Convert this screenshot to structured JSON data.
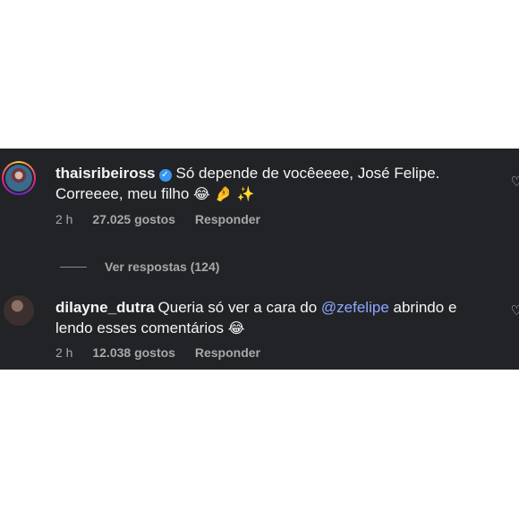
{
  "comments": [
    {
      "username": "thaisribeiross",
      "verified": true,
      "text_line1": "Só depende de vocêeeee, José Felipe.",
      "text_line2": "Correeee, meu filho",
      "emojis": "😂 🤌 ✨",
      "time": "2 h",
      "likes": "27.025 gostos",
      "reply_label": "Responder",
      "view_replies": "Ver respostas (124)"
    },
    {
      "username": "dilayne_dutra",
      "verified": false,
      "text_before": "Queria só ver a cara do ",
      "mention": "@zefelipe",
      "text_after": " abrindo e",
      "text_line2": "lendo esses comentários",
      "emojis": "😂",
      "time": "2 h",
      "likes": "12.038 gostos",
      "reply_label": "Responder"
    }
  ],
  "icons": {
    "heart": "heart-outline-icon",
    "verified": "verified-badge-icon"
  },
  "colors": {
    "background": "#212327",
    "text": "#f5f5f5",
    "meta": "#a8a8a8",
    "mention": "#8ea8ff",
    "verified": "#3897f0"
  }
}
